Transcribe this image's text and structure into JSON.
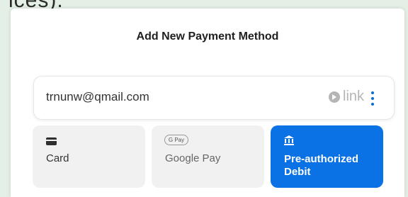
{
  "background_text": "ices).",
  "dialog": {
    "title": "Add New Payment Method"
  },
  "link_account": {
    "email": "trnunw@qmail.com",
    "brand": "link",
    "menu_icon": "kebab-menu-icon",
    "accent": "#0a6ed1"
  },
  "methods": [
    {
      "label": "Card",
      "icon": "credit-card-icon",
      "selected": false
    },
    {
      "label": "Google Pay",
      "icon": "google-pay-icon",
      "icon_text": "G Pay",
      "selected": false
    },
    {
      "label": "Pre-authorized Debit",
      "icon": "bank-icon",
      "selected": true
    }
  ],
  "colors": {
    "selected_bg": "#0a72e4",
    "unselected_bg": "#f1f1f1"
  }
}
